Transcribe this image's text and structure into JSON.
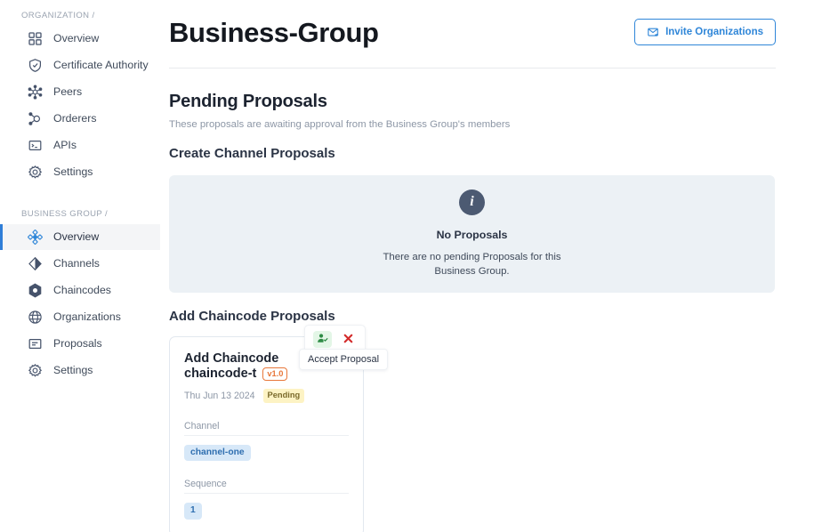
{
  "sidebar": {
    "sections": [
      {
        "label": "ORGANIZATION /",
        "items": [
          {
            "label": "Overview",
            "icon": "grid-icon",
            "active": false
          },
          {
            "label": "Certificate Authority",
            "icon": "shield-icon",
            "active": false
          },
          {
            "label": "Peers",
            "icon": "network-icon",
            "active": false
          },
          {
            "label": "Orderers",
            "icon": "branch-icon",
            "active": false
          },
          {
            "label": "APIs",
            "icon": "terminal-icon",
            "active": false
          },
          {
            "label": "Settings",
            "icon": "gear-icon",
            "active": false
          }
        ]
      },
      {
        "label": "BUSINESS GROUP /",
        "items": [
          {
            "label": "Overview",
            "icon": "diamond-cluster-icon",
            "active": true
          },
          {
            "label": "Channels",
            "icon": "half-diamond-icon",
            "active": false
          },
          {
            "label": "Chaincodes",
            "icon": "hexagon-icon",
            "active": false
          },
          {
            "label": "Organizations",
            "icon": "globe-icon",
            "active": false
          },
          {
            "label": "Proposals",
            "icon": "document-icon",
            "active": false
          },
          {
            "label": "Settings",
            "icon": "gear-icon",
            "active": false
          }
        ]
      }
    ]
  },
  "header": {
    "title": "Business-Group",
    "invite_button": {
      "label": "Invite Organizations",
      "icon": "invite-mail-icon"
    }
  },
  "pending": {
    "title": "Pending Proposals",
    "subtitle": "These proposals are awaiting approval from the Business Group's members",
    "create_channel_heading": "Create Channel Proposals",
    "empty_state": {
      "icon": "info-icon",
      "title": "No Proposals",
      "text": "There are no pending Proposals for this Business Group."
    },
    "add_chaincode_heading": "Add Chaincode Proposals"
  },
  "proposal_card": {
    "title": "Add Chaincode",
    "name": "chaincode-t",
    "version": "v1.0",
    "date": "Thu Jun 13 2024",
    "status": "Pending",
    "channel_label": "Channel",
    "channel_value": "channel-one",
    "sequence_label": "Sequence",
    "sequence_value": "1",
    "accept_icon": "person-check-icon",
    "reject_icon": "close-icon",
    "tooltip": "Accept Proposal"
  },
  "colors": {
    "accent_blue": "#2f86d8",
    "active_bar": "#2f7ed8",
    "version_orange": "#e8773a",
    "pending_yellow": "#fdf3c4",
    "chip_blue": "#d7e8f8",
    "panel_bg": "#ecf1f5",
    "info_circle": "#4c5a72",
    "accept_green": "#2e8b45",
    "reject_red": "#d32b2b"
  }
}
